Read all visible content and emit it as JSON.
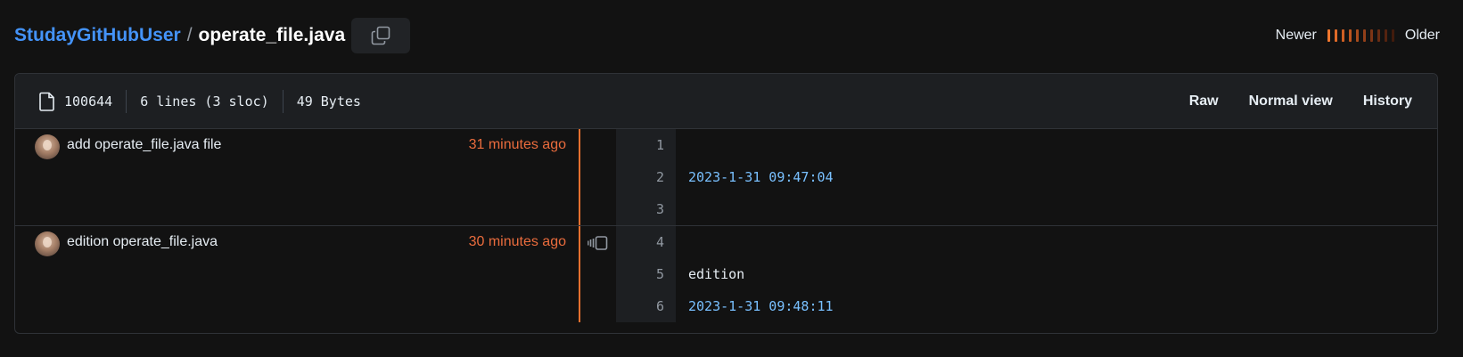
{
  "breadcrumb": {
    "owner": "StudayGitHubUser",
    "separator": "/",
    "file": "operate_file.java",
    "copy_icon": "copy-icon"
  },
  "age_legend": {
    "newer_label": "Newer",
    "older_label": "Older",
    "bar_colors": [
      "#f0772e",
      "#e06a28",
      "#d05f23",
      "#bd551f",
      "#a84b1c",
      "#923f19",
      "#7d3516",
      "#692c13",
      "#55230f",
      "#421b0c"
    ]
  },
  "file_meta": {
    "icon": "file-icon",
    "mode": "100644",
    "lines": "6 lines (3 sloc)",
    "size": "49 Bytes"
  },
  "actions": {
    "raw": "Raw",
    "normal_view": "Normal view",
    "history": "History"
  },
  "colors": {
    "accent_link": "#4493f8",
    "commit_age": "#ea6c3d",
    "age_bar": "#e8702e",
    "code_string": "#79c0ff"
  },
  "hunks": [
    {
      "commit_message": "add operate_file.java file",
      "commit_time": "31 minutes ago",
      "avatar_icon": "avatar-icon",
      "has_reblame": false,
      "lines": [
        {
          "number": "1",
          "text": "",
          "style": "plain"
        },
        {
          "number": "2",
          "text": "2023-1-31 09:47:04",
          "style": "blue"
        },
        {
          "number": "3",
          "text": "",
          "style": "plain"
        }
      ]
    },
    {
      "commit_message": "edition operate_file.java",
      "commit_time": "30 minutes ago",
      "avatar_icon": "avatar-icon",
      "has_reblame": true,
      "reblame_icon": "reblame-icon",
      "lines": [
        {
          "number": "4",
          "text": "",
          "style": "plain"
        },
        {
          "number": "5",
          "text": "edition",
          "style": "plain"
        },
        {
          "number": "6",
          "text": "2023-1-31 09:48:11",
          "style": "blue"
        }
      ]
    }
  ]
}
